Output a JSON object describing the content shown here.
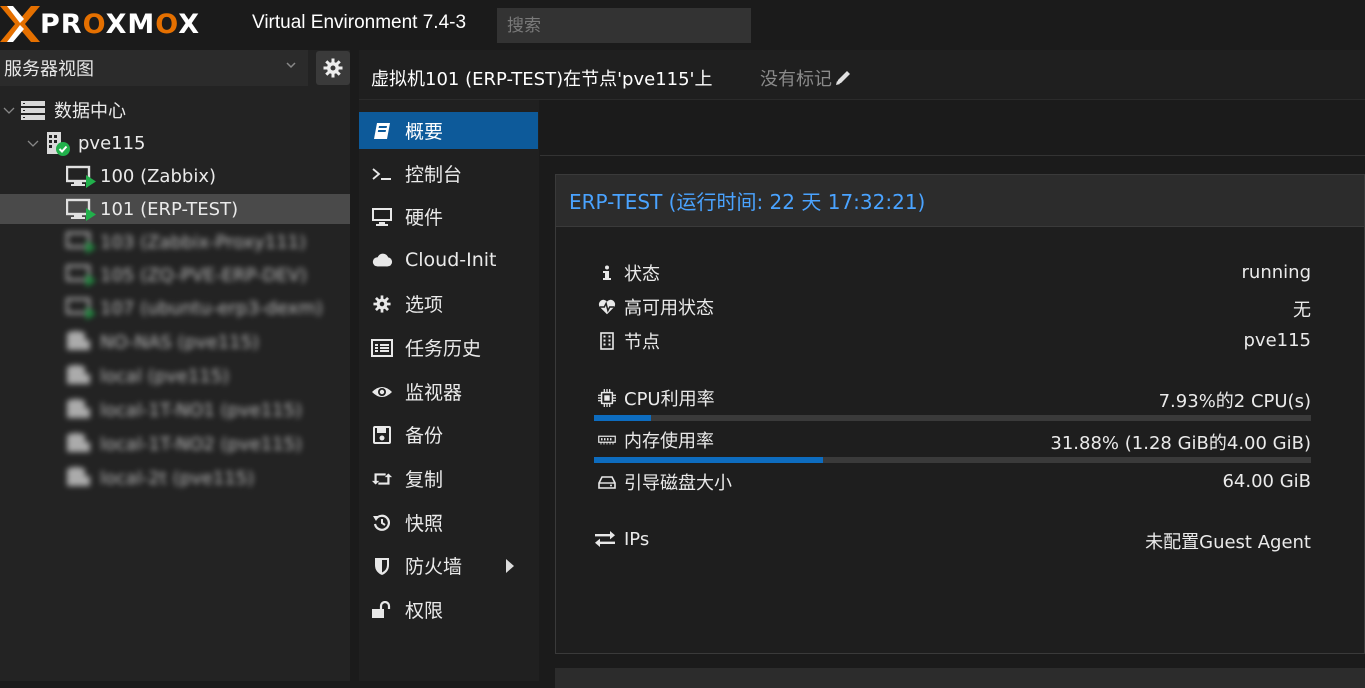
{
  "header": {
    "logo_text_a": "PR",
    "logo_text_b": "O",
    "logo_text_c": "XM",
    "logo_text_d": "O",
    "logo_text_e": "X",
    "app_title": "Virtual Environment 7.4-3",
    "search_placeholder": "搜索"
  },
  "sidebar": {
    "view_select": "服务器视图",
    "tree": [
      {
        "label": "数据中心",
        "icon": "datacenter-icon"
      },
      {
        "label": "pve115",
        "icon": "node-icon"
      },
      {
        "label": "100 (Zabbix)",
        "icon": "vm-running-icon"
      },
      {
        "label": "101 (ERP-TEST)",
        "icon": "vm-running-icon",
        "selected": true
      },
      {
        "label": "103 (Zabbix-Proxy111)",
        "icon": "vm-running-icon",
        "blurred": true
      },
      {
        "label": "105 (ZQ-PVE-ERP-DEV)",
        "icon": "vm-running-icon",
        "blurred": true
      },
      {
        "label": "107 (ubuntu-erp3-dexm)",
        "icon": "vm-running-icon",
        "blurred": true
      },
      {
        "label": "NO-NAS (pve115)",
        "icon": "storage-icon",
        "blurred": true
      },
      {
        "label": "local (pve115)",
        "icon": "storage-icon",
        "blurred": true
      },
      {
        "label": "local-1T-NO1 (pve115)",
        "icon": "storage-icon",
        "blurred": true
      },
      {
        "label": "local-1T-NO2 (pve115)",
        "icon": "storage-icon",
        "blurred": true
      },
      {
        "label": "local-2t (pve115)",
        "icon": "storage-icon",
        "blurred": true
      }
    ]
  },
  "content_header": {
    "title": "虚拟机101 (ERP-TEST)在节点'pve115'上",
    "no_tags": "没有标记"
  },
  "nav": {
    "items": [
      {
        "label": "概要",
        "icon": "book-icon",
        "active": true
      },
      {
        "label": "控制台",
        "icon": "terminal-icon"
      },
      {
        "label": "硬件",
        "icon": "monitor-icon"
      },
      {
        "label": "Cloud-Init",
        "icon": "cloud-icon"
      },
      {
        "label": "选项",
        "icon": "gear-icon"
      },
      {
        "label": "任务历史",
        "icon": "list-icon"
      },
      {
        "label": "监视器",
        "icon": "eye-icon"
      },
      {
        "label": "备份",
        "icon": "floppy-icon"
      },
      {
        "label": "复制",
        "icon": "retweet-icon"
      },
      {
        "label": "快照",
        "icon": "history-icon"
      },
      {
        "label": "防火墙",
        "icon": "shield-icon",
        "has_submenu": true
      },
      {
        "label": "权限",
        "icon": "unlock-icon"
      }
    ]
  },
  "summary": {
    "panel_title": "ERP-TEST (运行时间: 22 天 17:32:21)",
    "rows": {
      "status": {
        "label": "状态",
        "value": "running"
      },
      "ha": {
        "label": "高可用状态",
        "value": "无"
      },
      "node": {
        "label": "节点",
        "value": "pve115"
      },
      "cpu": {
        "label": "CPU利用率",
        "value": "7.93%的2 CPU(s)",
        "fraction": 0.0793
      },
      "memory": {
        "label": "内存使用率",
        "value": "31.88% (1.28 GiB的4.00 GiB)",
        "fraction": 0.3188
      },
      "bootdisk": {
        "label": "引导磁盘大小",
        "value": "64.00 GiB"
      },
      "ips": {
        "label": "IPs",
        "value": "未配置Guest Agent"
      }
    }
  },
  "colors": {
    "accent": "#0d5a9a",
    "title_blue": "#4aa3ff",
    "logo_orange": "#e57000",
    "running_green": "#21b04b"
  }
}
